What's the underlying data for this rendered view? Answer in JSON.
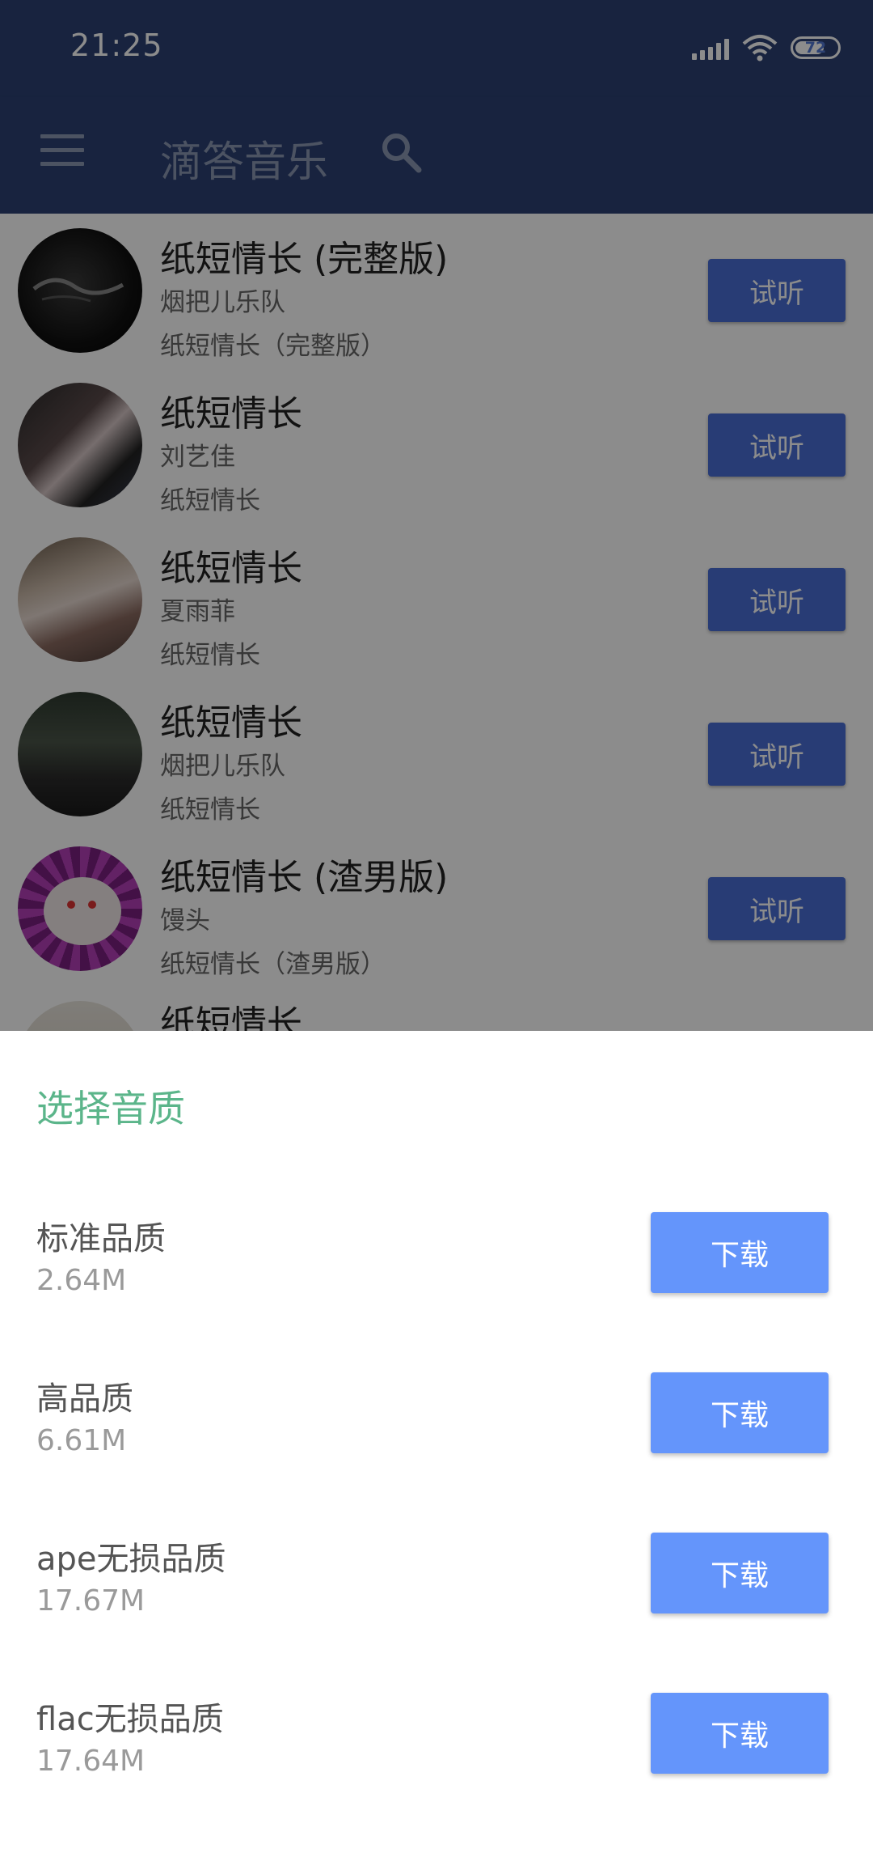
{
  "status_bar": {
    "time": "21:25",
    "battery": "72"
  },
  "app_bar": {
    "title": "滴答音乐"
  },
  "songs": [
    {
      "title": "纸短情长 (完整版)",
      "artist": "烟把儿乐队",
      "album": "纸短情长（完整版）",
      "button": "试听"
    },
    {
      "title": "纸短情长",
      "artist": "刘艺佳",
      "album": "纸短情长",
      "button": "试听"
    },
    {
      "title": "纸短情长",
      "artist": "夏雨菲",
      "album": "纸短情长",
      "button": "试听"
    },
    {
      "title": "纸短情长",
      "artist": "烟把儿乐队",
      "album": "纸短情长",
      "button": "试听"
    },
    {
      "title": "纸短情长 (渣男版)",
      "artist": "馒头",
      "album": "纸短情长（渣男版）",
      "button": "试听"
    },
    {
      "title": "纸短情长",
      "artist": "",
      "album": "",
      "button": ""
    }
  ],
  "quality_sheet": {
    "title": "选择音质",
    "options": [
      {
        "name": "标准品质",
        "size": "2.64M",
        "button": "下载"
      },
      {
        "name": "高品质",
        "size": "6.61M",
        "button": "下载"
      },
      {
        "name": "ape无损品质",
        "size": "17.67M",
        "button": "下载"
      },
      {
        "name": "flac无损品质",
        "size": "17.64M",
        "button": "下载"
      }
    ]
  },
  "colors": {
    "primary": "#2c4173",
    "listen_button": "#4a6ed6",
    "download_button": "#6495fb",
    "sheet_title": "#5bb58a"
  }
}
